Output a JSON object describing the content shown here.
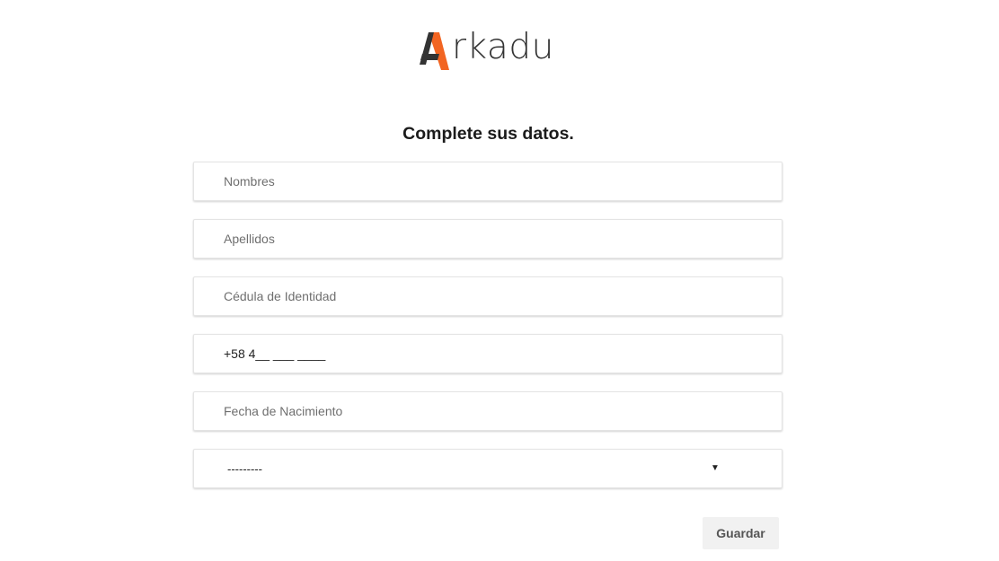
{
  "brand": {
    "logo_text": "rkadu",
    "colors": {
      "orange": "#f26522",
      "dark": "#333333"
    }
  },
  "page": {
    "title": "Complete sus datos."
  },
  "form": {
    "nombres_placeholder": "Nombres",
    "apellidos_placeholder": "Apellidos",
    "cedula_placeholder": "Cédula de Identidad",
    "telefono_value": "+58 4__ ___ ____",
    "fecha_nacimiento_placeholder": "Fecha de Nacimiento",
    "select_value": "---------",
    "select_caret": "▼"
  },
  "actions": {
    "save_label": "Guardar"
  }
}
